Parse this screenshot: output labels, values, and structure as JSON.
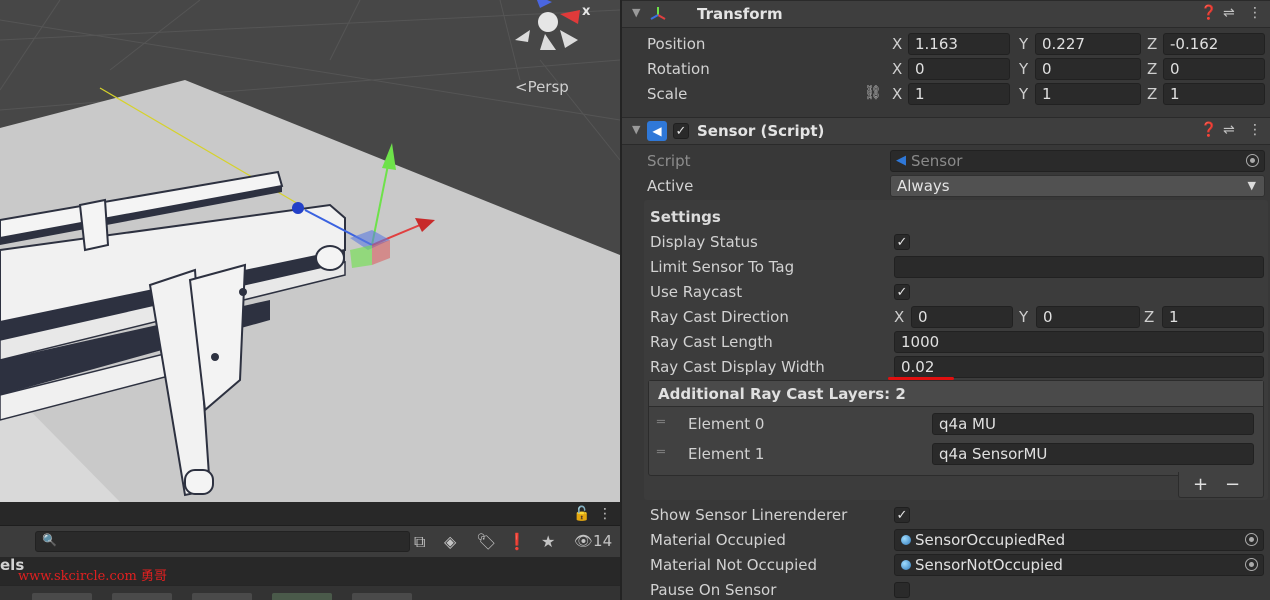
{
  "scene": {
    "camera_mode": "<Persp",
    "gizmo_axis_label": "x"
  },
  "project": {
    "search_placeholder": "",
    "hidden_count": "14",
    "folder_label": "els",
    "watermark": "www.skcircle.com 勇哥"
  },
  "transform": {
    "title": "Transform",
    "rows": [
      {
        "label": "Position",
        "x": "1.163",
        "y": "0.227",
        "z": "-0.162"
      },
      {
        "label": "Rotation",
        "x": "0",
        "y": "0",
        "z": "0"
      },
      {
        "label": "Scale",
        "x": "1",
        "y": "1",
        "z": "1"
      }
    ],
    "axis": {
      "x": "X",
      "y": "Y",
      "z": "Z"
    }
  },
  "sensor": {
    "title": "Sensor (Script)",
    "script_label": "Script",
    "script_value": "Sensor",
    "active_label": "Active",
    "active_value": "Always",
    "settings_title": "Settings",
    "display_status_label": "Display Status",
    "display_status": true,
    "limit_tag_label": "Limit Sensor To Tag",
    "limit_tag_value": "",
    "use_raycast_label": "Use Raycast",
    "use_raycast": true,
    "ray_dir_label": "Ray Cast Direction",
    "ray_dir": {
      "x": "0",
      "y": "0",
      "z": "1"
    },
    "ray_len_label": "Ray Cast Length",
    "ray_len": "1000",
    "ray_width_label": "Ray Cast Display Width",
    "ray_width": "0.02",
    "layers_title": "Additional Ray Cast Layers: 2",
    "layers": [
      {
        "label": "Element 0",
        "value": "q4a MU"
      },
      {
        "label": "Element 1",
        "value": "q4a SensorMU"
      }
    ],
    "add_symbol": "+",
    "remove_symbol": "−",
    "show_line_label": "Show Sensor Linerenderer",
    "show_line": true,
    "mat_occupied_label": "Material Occupied",
    "mat_occupied": "SensorOccupiedRed",
    "mat_not_occupied_label": "Material Not Occupied",
    "mat_not_occupied": "SensorNotOccupied",
    "pause_label": "Pause On Sensor",
    "pause": false
  },
  "colors": {
    "annotation_red": "#e01010",
    "accent_blue": "#2f78d8"
  }
}
